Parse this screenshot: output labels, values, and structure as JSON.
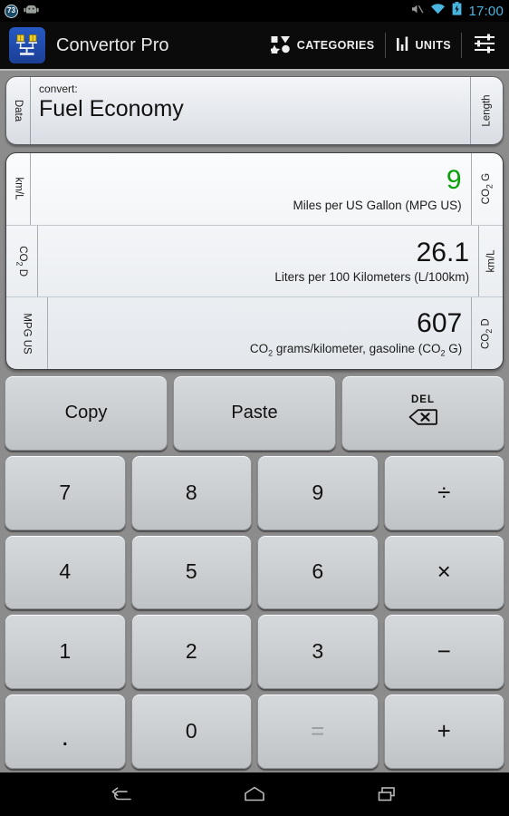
{
  "statusbar": {
    "left_icons": [
      {
        "name": "alarm-badge-icon",
        "label": "73"
      },
      {
        "name": "android-robot-icon",
        "label": ""
      }
    ],
    "right_icons": [
      {
        "name": "mute-icon"
      },
      {
        "name": "wifi-icon"
      },
      {
        "name": "battery-charging-icon"
      }
    ],
    "clock": "17:00",
    "accent_color": "#4ab6e0"
  },
  "actionbar": {
    "app_icon_name": "convertor-pro-app-icon",
    "title": "Convertor Pro",
    "categories_label": "CATEGORIES",
    "units_label": "UNITS",
    "settings_icon_name": "sliders-settings-icon"
  },
  "convert_panel": {
    "label": "convert:",
    "value": "Fuel Economy",
    "left_tab": "Data",
    "right_tab": "Length"
  },
  "results": {
    "rows": [
      {
        "value": "9",
        "value_color": "#09a009",
        "unit": "Miles per US Gallon (MPG US)",
        "left_tab": "km/L",
        "right_tab": "CO₂ G",
        "active": true
      },
      {
        "value": "26.1",
        "value_color": "#111111",
        "unit": "Liters per 100 Kilometers (L/100km)",
        "left_tab": "CO₂ D",
        "right_tab": "km/L",
        "active": false
      },
      {
        "value": "607",
        "value_color": "#111111",
        "unit": "CO₂ grams/kilometer, gasoline (CO₂ G)",
        "left_tab": "MPG US",
        "right_tab": "CO₂ D",
        "active": false
      }
    ]
  },
  "keypad": {
    "rows": [
      [
        {
          "name": "copy-key",
          "label": "Copy",
          "type": "text",
          "disabled": false
        },
        {
          "name": "paste-key",
          "label": "Paste",
          "type": "text",
          "disabled": false
        },
        {
          "name": "delete-key",
          "label": "DEL",
          "type": "del",
          "disabled": false
        }
      ],
      [
        {
          "name": "key-7",
          "label": "7",
          "type": "digit",
          "disabled": false
        },
        {
          "name": "key-8",
          "label": "8",
          "type": "digit",
          "disabled": false
        },
        {
          "name": "key-9",
          "label": "9",
          "type": "digit",
          "disabled": false
        },
        {
          "name": "key-divide",
          "label": "÷",
          "type": "op",
          "disabled": false
        }
      ],
      [
        {
          "name": "key-4",
          "label": "4",
          "type": "digit",
          "disabled": false
        },
        {
          "name": "key-5",
          "label": "5",
          "type": "digit",
          "disabled": false
        },
        {
          "name": "key-6",
          "label": "6",
          "type": "digit",
          "disabled": false
        },
        {
          "name": "key-multiply",
          "label": "×",
          "type": "op",
          "disabled": false
        }
      ],
      [
        {
          "name": "key-1",
          "label": "1",
          "type": "digit",
          "disabled": false
        },
        {
          "name": "key-2",
          "label": "2",
          "type": "digit",
          "disabled": false
        },
        {
          "name": "key-3",
          "label": "3",
          "type": "digit",
          "disabled": false
        },
        {
          "name": "key-minus",
          "label": "−",
          "type": "op",
          "disabled": false
        }
      ],
      [
        {
          "name": "key-decimal",
          "label": ".",
          "type": "dot",
          "disabled": false
        },
        {
          "name": "key-0",
          "label": "0",
          "type": "digit",
          "disabled": false
        },
        {
          "name": "key-equals",
          "label": "=",
          "type": "op",
          "disabled": true
        },
        {
          "name": "key-plus",
          "label": "+",
          "type": "op",
          "disabled": false
        }
      ]
    ]
  },
  "navbar": {
    "back_icon": "back-icon",
    "home_icon": "home-icon",
    "recents_icon": "recents-icon"
  }
}
